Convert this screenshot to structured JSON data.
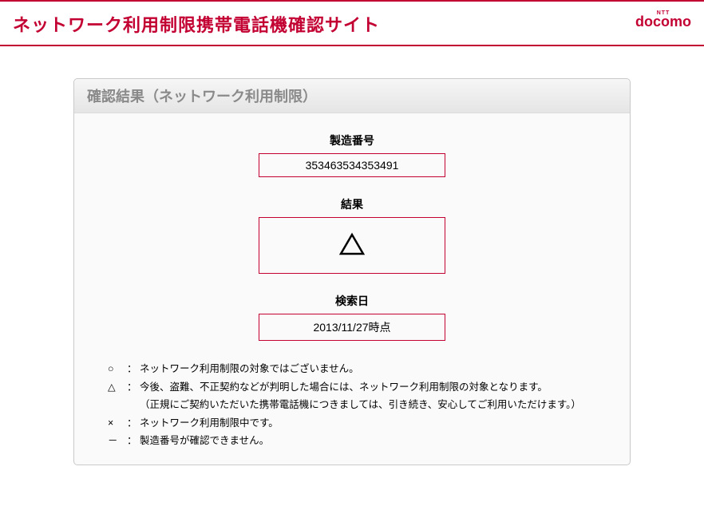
{
  "header": {
    "site_title": "ネットワーク利用制限携帯電話機確認サイト",
    "logo_small": "NTT",
    "logo_main": "docomo"
  },
  "panel": {
    "header": "確認結果（ネットワーク利用制限）",
    "fields": {
      "serial_label": "製造番号",
      "serial_value": "353463534353491",
      "result_label": "結果",
      "result_symbol_name": "triangle-icon",
      "date_label": "検索日",
      "date_value": "2013/11/27時点"
    },
    "legend": {
      "rows": [
        {
          "sym": "○",
          "text": "ネットワーク利用制限の対象ではございません。"
        },
        {
          "sym": "△",
          "text": "今後、盗難、不正契約などが判明した場合には、ネットワーク利用制限の対象となります。",
          "sub": "（正規にご契約いただいた携帯電話機につきましては、引き続き、安心してご利用いただけます。）"
        },
        {
          "sym": "×",
          "text": "ネットワーク利用制限中です。"
        },
        {
          "sym": "－",
          "text": "製造番号が確認できません。"
        }
      ]
    }
  }
}
